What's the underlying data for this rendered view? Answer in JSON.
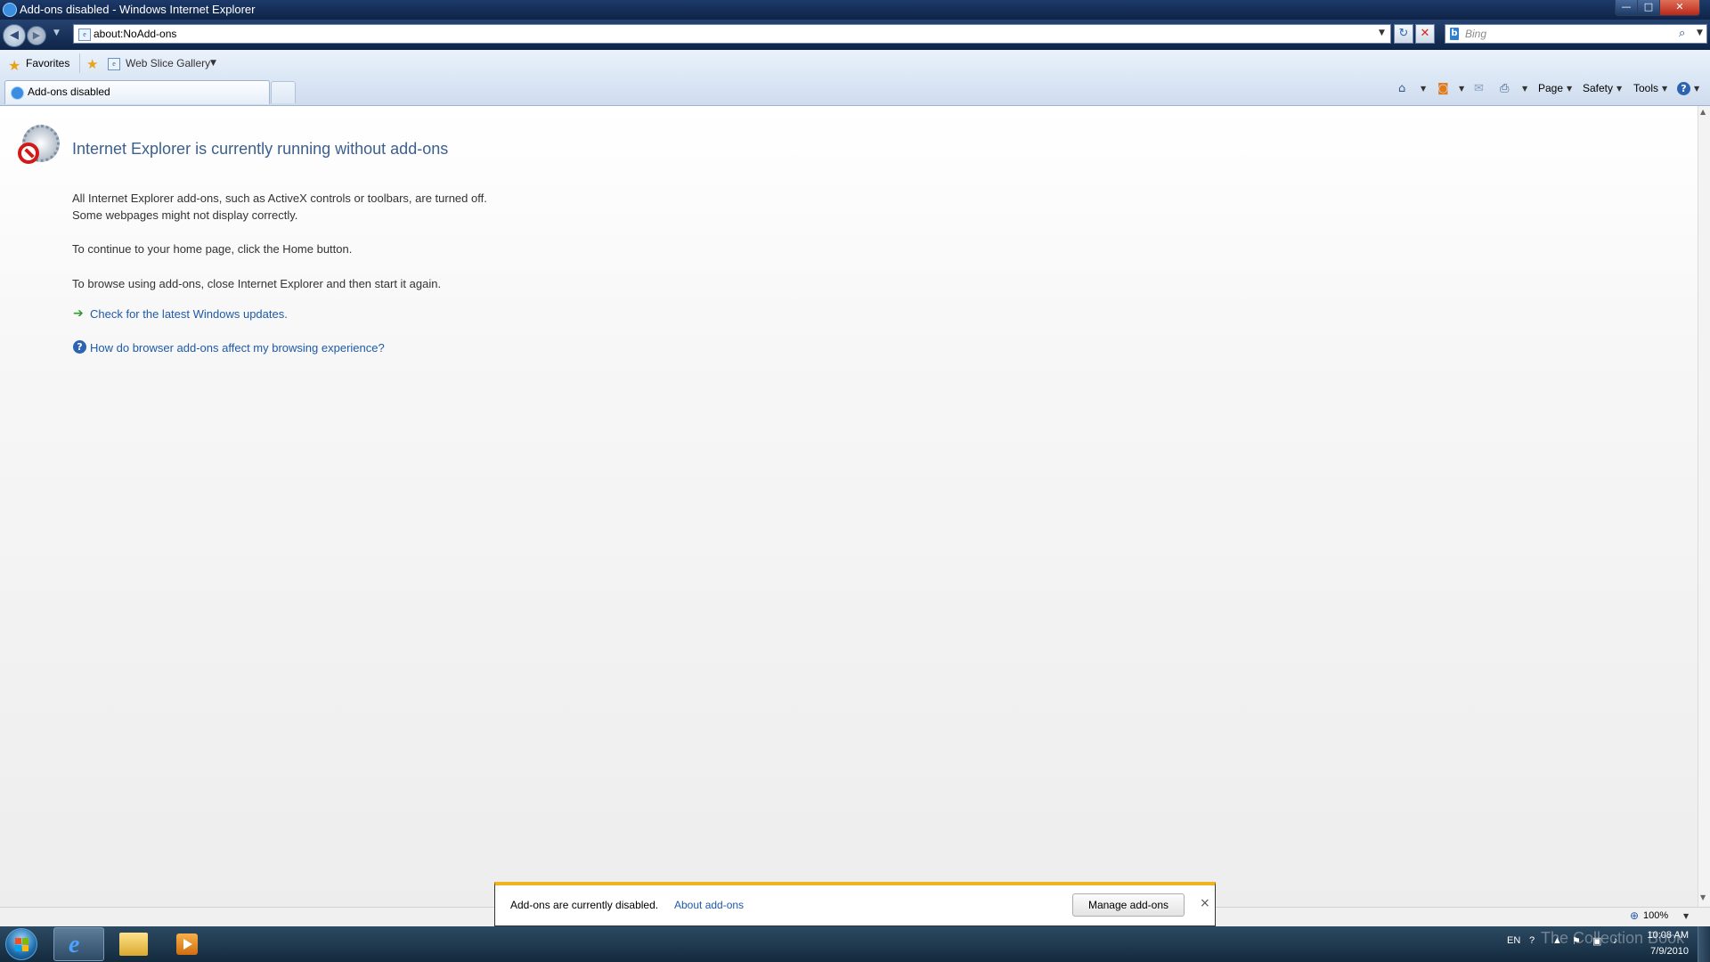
{
  "window": {
    "title": "Add-ons disabled - Windows Internet Explorer",
    "controls": {
      "minimize": "—",
      "maximize": "□",
      "close": "✕"
    }
  },
  "nav": {
    "address": "about:NoAdd-ons",
    "search_placeholder": "Bing"
  },
  "favorites_bar": {
    "favorites_label": "Favorites",
    "web_slice_label": "Web Slice Gallery"
  },
  "tabs": [
    {
      "label": "Add-ons disabled",
      "active": true
    }
  ],
  "command_bar": {
    "page": "Page",
    "safety": "Safety",
    "tools": "Tools"
  },
  "content": {
    "heading": "Internet Explorer is currently running without add-ons",
    "para1_line1": "All Internet Explorer add-ons, such as ActiveX controls or toolbars, are turned off.",
    "para1_line2": "Some webpages might not display correctly.",
    "para2": "To continue to your home page, click the Home button.",
    "para3": "To browse using add-ons, close Internet Explorer and then start it again.",
    "link_updates": "Check for the latest Windows updates.",
    "link_help": "How do browser add-ons affect my browsing experience?"
  },
  "notification": {
    "message": "Add-ons are currently disabled.",
    "about_link": "About add-ons",
    "manage_button": "Manage add-ons",
    "accent_color": "#f2b21e"
  },
  "status_bar": {
    "zoom": "100%"
  },
  "taskbar": {
    "language": "EN",
    "time": "10:08 AM",
    "date": "7/9/2010",
    "watermark": "The Collection Book"
  },
  "icons": {
    "back": "back-arrow-icon",
    "forward": "forward-arrow-icon",
    "refresh": "refresh-icon",
    "stop": "stop-icon",
    "search": "search-icon",
    "home": "home-icon",
    "feeds": "rss-icon",
    "mail": "mail-icon",
    "print": "print-icon",
    "help": "help-icon"
  }
}
